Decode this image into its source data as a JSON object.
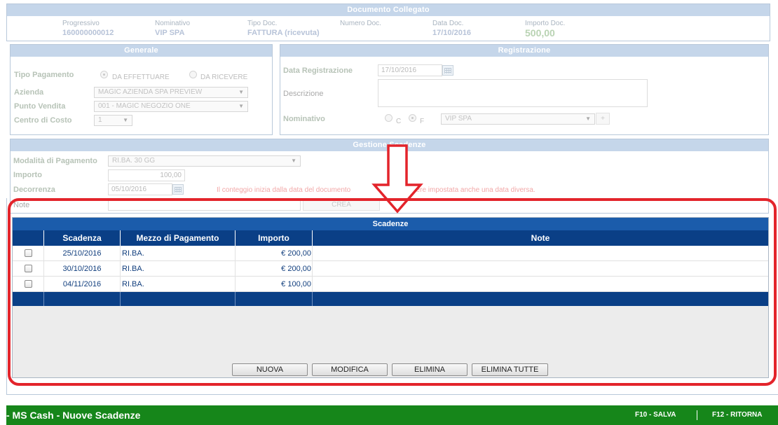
{
  "documento": {
    "title": "Documento Collegato",
    "fields": [
      {
        "label": "Progressivo",
        "value": "160000000012"
      },
      {
        "label": "Nominativo",
        "value": "VIP SPA"
      },
      {
        "label": "Tipo Doc.",
        "value": "FATTURA (ricevuta)"
      },
      {
        "label": "Numero Doc.",
        "value": ""
      },
      {
        "label": "Data Doc.",
        "value": "17/10/2016"
      },
      {
        "label": "Importo Doc.",
        "value": "500,00"
      }
    ]
  },
  "generale": {
    "title": "Generale",
    "tipo_pagamento_label": "Tipo Pagamento",
    "radio_effettuare": "DA EFFETTUARE",
    "radio_ricevere": "DA RICEVERE",
    "azienda_label": "Azienda",
    "azienda_value": "MAGIC AZIENDA SPA PREVIEW",
    "punto_vendita_label": "Punto Vendita",
    "punto_vendita_value": "001 - MAGIC NEGOZIO ONE",
    "centro_costo_label": "Centro di Costo",
    "centro_costo_value": "1"
  },
  "registrazione": {
    "title": "Registrazione",
    "data_label": "Data Registrazione",
    "data_value": "17/10/2016",
    "descrizione_label": "Descrizione",
    "nominativo_label": "Nominativo",
    "radio_c": "C",
    "radio_f": "F",
    "nominativo_value": "VIP SPA",
    "add_label": "+"
  },
  "gestione": {
    "title": "Gestione Scadenze",
    "modalita_label": "Modalità di Pagamento",
    "modalita_value": "RI.BA. 30 GG",
    "importo_label": "Importo",
    "importo_value": "100,00",
    "decorrenza_label": "Decorrenza",
    "decorrenza_value": "05/10/2016",
    "note_label": "Note",
    "crea_label": "CREA",
    "warning_a": "Il conteggio inizia dalla data del documento",
    "warning_b": "essere impostata anche una data diversa."
  },
  "scadenze": {
    "title": "Scadenze",
    "columns": [
      "Scadenza",
      "Mezzo di Pagamento",
      "Importo",
      "Note"
    ],
    "rows": [
      {
        "scadenza": "25/10/2016",
        "mezzo": "RI.BA.",
        "importo": "€ 200,00",
        "note": ""
      },
      {
        "scadenza": "30/10/2016",
        "mezzo": "RI.BA.",
        "importo": "€ 200,00",
        "note": ""
      },
      {
        "scadenza": "04/11/2016",
        "mezzo": "RI.BA.",
        "importo": "€ 100,00",
        "note": ""
      }
    ],
    "buttons": {
      "nuova": "NUOVA",
      "modifica": "MODIFICA",
      "elimina": "ELIMINA",
      "elimina_tutte": "ELIMINA TUTTE"
    }
  },
  "footer": {
    "title": "- MS Cash - Nuove Scadenze",
    "f10": "F10 - SALVA",
    "f12": "F12 - RITORNA"
  },
  "colors": {
    "accent": "#0a3f86",
    "footer": "#16861a",
    "highlight": "#e3242b"
  }
}
